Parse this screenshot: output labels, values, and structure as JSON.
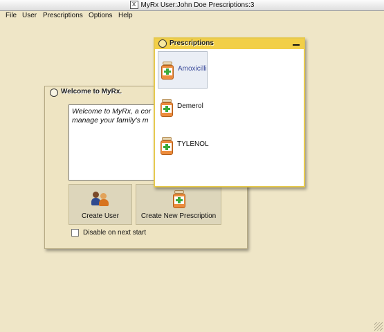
{
  "window": {
    "title": "MyRx User:John Doe  Prescriptions:3",
    "x_glyph": "X"
  },
  "menu": [
    "File",
    "User",
    "Prescriptions",
    "Options",
    "Help"
  ],
  "welcome": {
    "title": "Welcome to MyRx.",
    "text_line1": "Welcome to MyRx, a cor",
    "text_line2": "manage your family's m",
    "create_user_label": "Create User",
    "create_rx_label": "Create New Prescription",
    "disable_label": "Disable on next start",
    "disable_checked": false
  },
  "prescriptions_window": {
    "title": "Prescriptions",
    "items": [
      {
        "name": "Amoxicillin",
        "selected": true
      },
      {
        "name": "Demerol",
        "selected": false
      },
      {
        "name": "TYLENOL",
        "selected": false
      }
    ]
  },
  "colors": {
    "background": "#efe6c7",
    "rx_header": "#f2cf47",
    "selection_text": "#3a4a9a"
  }
}
